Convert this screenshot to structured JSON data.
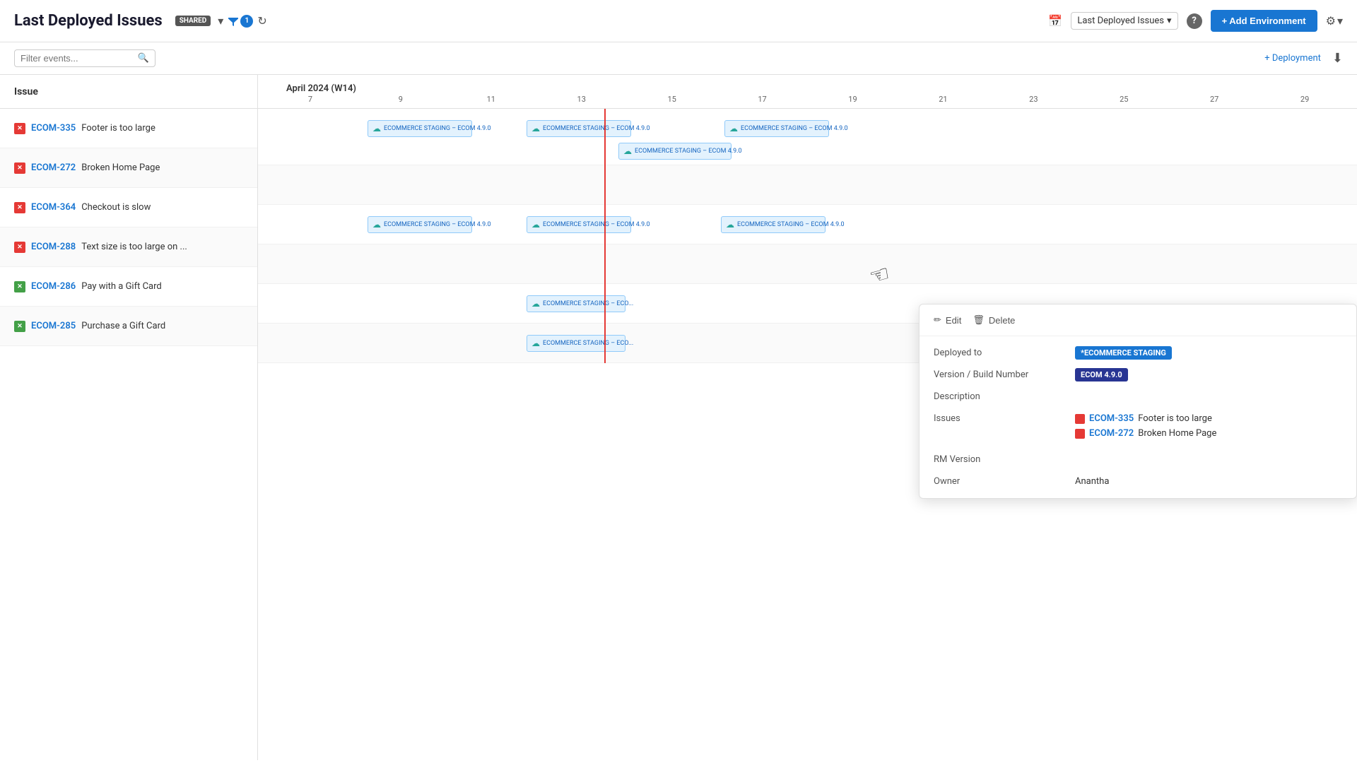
{
  "header": {
    "title": "Last Deployed Issues",
    "badge_shared": "SHARED",
    "filter_count": "1",
    "selector_label": "Last Deployed Issues",
    "add_env_label": "+ Add Environment"
  },
  "toolbar": {
    "search_placeholder": "Filter events...",
    "deployment_label": "+ Deployment"
  },
  "timeline": {
    "month_label": "April 2024 (W14)",
    "dates": [
      "7",
      "9",
      "11",
      "13",
      "15",
      "17",
      "19",
      "21",
      "23",
      "25",
      "27",
      "29"
    ]
  },
  "issues": [
    {
      "id": "ECOM-335",
      "title": "Footer is too large",
      "status": "red"
    },
    {
      "id": "ECOM-272",
      "title": "Broken Home Page",
      "status": "red"
    },
    {
      "id": "ECOM-364",
      "title": "Checkout is slow",
      "status": "red"
    },
    {
      "id": "ECOM-288",
      "title": "Text size is too large on ...",
      "status": "red"
    },
    {
      "id": "ECOM-286",
      "title": "Pay with a Gift Card",
      "status": "green"
    },
    {
      "id": "ECOM-285",
      "title": "Purchase a Gift Card",
      "status": "green"
    }
  ],
  "issue_header": "Issue",
  "popup": {
    "edit_label": "Edit",
    "delete_label": "Delete",
    "deployed_to_label": "Deployed to",
    "deployed_to_value": "*ECOMMERCE STAGING",
    "version_label": "Version / Build Number",
    "version_value": "ECOM 4.9.0",
    "description_label": "Description",
    "issues_label": "Issues",
    "rm_version_label": "RM Version",
    "owner_label": "Owner",
    "owner_value": "Anantha",
    "linked_issues": [
      {
        "id": "ECOM-335",
        "title": "Footer is too large"
      },
      {
        "id": "ECOM-272",
        "title": "Broken Home Page"
      }
    ]
  }
}
